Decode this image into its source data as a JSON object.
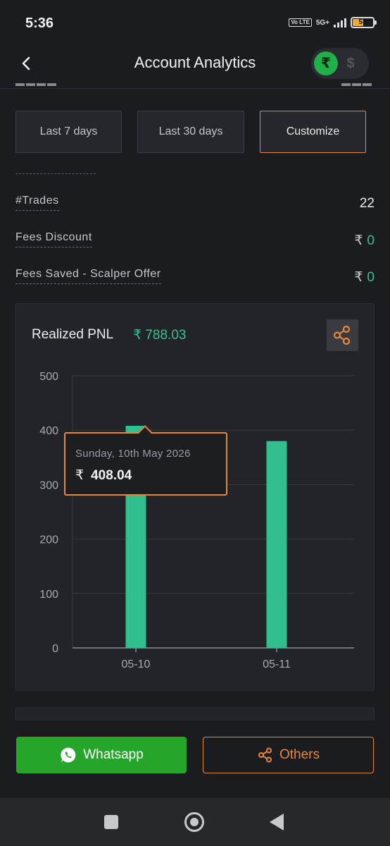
{
  "status_bar": {
    "time": "5:36",
    "volte": "Vo LTE",
    "network": "5G+",
    "battery": "53"
  },
  "header": {
    "title": "Account Analytics",
    "currency_inr": "₹",
    "currency_usd": "$"
  },
  "filters": [
    {
      "label": "Last 7 days",
      "active": false
    },
    {
      "label": "Last 30 days",
      "active": false
    },
    {
      "label": "Customize",
      "active": true
    }
  ],
  "metrics": [
    {
      "label": "#Trades",
      "value": "22",
      "currency": ""
    },
    {
      "label": "Fees Discount",
      "value": "0",
      "currency": "₹"
    },
    {
      "label": "Fees Saved - Scalper Offer",
      "value": "0",
      "currency": "₹"
    }
  ],
  "pnl": {
    "title": "Realized PNL",
    "value": "₹ 788.03"
  },
  "tooltip": {
    "date": "Sunday, 10th May 2026",
    "currency": "₹",
    "value": "408.04"
  },
  "chart_data": {
    "type": "bar",
    "categories": [
      "05-10",
      "05-11"
    ],
    "values": [
      408.04,
      379.99
    ],
    "ylim": [
      0,
      500
    ],
    "yticks": [
      0,
      100,
      200,
      300,
      400,
      500
    ],
    "grid": true,
    "bar_color": "#32bf8f"
  },
  "share": {
    "whatsapp_label": "Whatsapp",
    "others_label": "Others"
  },
  "colors": {
    "accent": "#e8863a",
    "positive": "#38c08f",
    "whatsapp": "#26a52b"
  }
}
